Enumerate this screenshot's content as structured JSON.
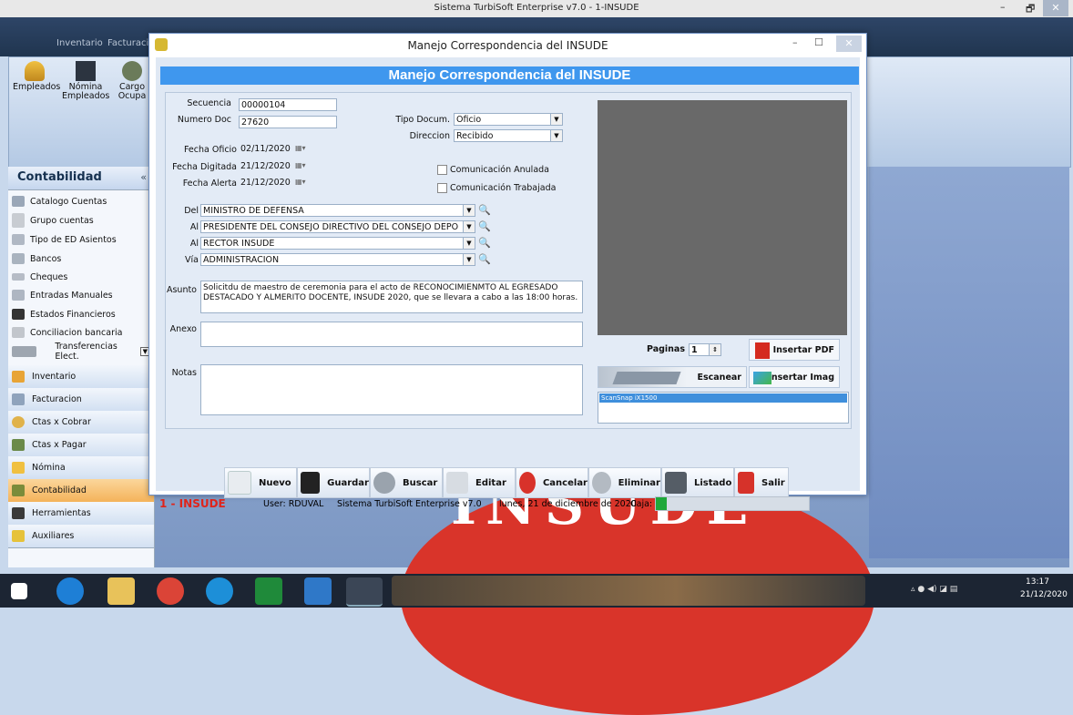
{
  "outer_window": {
    "title": "Sistema TurbiSoft Enterprise v7.0 - 1-INSUDE",
    "controls": [
      "–",
      "🗗",
      "✕"
    ],
    "menu": [
      "Inventario",
      "Facturacio"
    ]
  },
  "ribbon": {
    "buttons": [
      {
        "label": "Empleados",
        "icon": "employees-icon"
      },
      {
        "label": "Nómina Empleados",
        "icon": "payroll-icon"
      },
      {
        "label": "Cargo Ocupa",
        "icon": "position-icon"
      }
    ]
  },
  "left_panel": {
    "header": "Contabilidad",
    "collapse": "«",
    "items": [
      {
        "label": "Catalogo Cuentas",
        "icon": "catalog-icon"
      },
      {
        "label": "Grupo cuentas",
        "icon": "group-icon"
      },
      {
        "label": "Tipo de ED Asientos",
        "icon": "entries-type-icon"
      },
      {
        "label": "Bancos",
        "icon": "bank-icon"
      },
      {
        "label": "Cheques",
        "icon": "cheque-icon"
      },
      {
        "label": "Entradas Manuales",
        "icon": "manual-entries-icon"
      },
      {
        "label": "Estados Financieros",
        "icon": "financial-statements-icon"
      },
      {
        "label": "Conciliacion bancaria",
        "icon": "reconciliation-icon"
      },
      {
        "label": "Transferencias Elect.",
        "icon": "transfer-icon"
      }
    ],
    "nav": [
      {
        "label": "Inventario",
        "icon": "inventory-icon",
        "active": false
      },
      {
        "label": "Facturacion",
        "icon": "billing-icon",
        "active": false
      },
      {
        "label": "Ctas x Cobrar",
        "icon": "receivables-icon",
        "active": false
      },
      {
        "label": "Ctas x Pagar",
        "icon": "payables-icon",
        "active": false
      },
      {
        "label": "Nómina",
        "icon": "payroll-nav-icon",
        "active": false
      },
      {
        "label": "Contabilidad",
        "icon": "accounting-icon",
        "active": true
      },
      {
        "label": "Herramientas",
        "icon": "tools-icon",
        "active": false
      },
      {
        "label": "Auxiliares",
        "icon": "auxiliary-icon",
        "active": false
      }
    ]
  },
  "background_logo": {
    "text": "INSUDE"
  },
  "dialog": {
    "title": "Manejo Correspondencia del INSUDE",
    "banner": "Manejo Correspondencia del INSUDE",
    "controls": [
      "–",
      "☐",
      "✕"
    ],
    "fields": {
      "secuencia_label": "Secuencia",
      "secuencia_value": "00000104",
      "numero_doc_label": "Numero Doc",
      "numero_doc_value": "27620",
      "tipo_docum_label": "Tipo Docum.",
      "tipo_docum_value": "Oficio",
      "direccion_label": "Direccion",
      "direccion_value": "Recibido",
      "fecha_oficio_label": "Fecha Oficio",
      "fecha_oficio_value": "02/11/2020",
      "fecha_digitada_label": "Fecha Digitada",
      "fecha_digitada_value": "21/12/2020",
      "fecha_alerta_label": "Fecha Alerta",
      "fecha_alerta_value": "21/12/2020",
      "comunicacion_anulada": "Comunicación Anulada",
      "comunicacion_trabajada": "Comunicación Trabajada",
      "del_label": "Del",
      "del_value": "MINISTRO DE DEFENSA",
      "al1_label": "Al",
      "al1_value": "PRESIDENTE DEL CONSEJO DIRECTIVO DEL CONSEJO DEPO",
      "al2_label": "Al",
      "al2_value": "RECTOR INSUDE",
      "via_label": "Vía",
      "via_value": "ADMINISTRACION",
      "asunto_label": "Asunto",
      "asunto_value": "Solicitdu de maestro de ceremonia para el acto de RECONOCIMIENMTO AL EGRESADO DESTACADO Y ALMERITO DOCENTE, INSUDE 2020, que se llevara a cabo a las 18:00 horas.",
      "anexo_label": "Anexo",
      "anexo_value": "",
      "notas_label": "Notas",
      "notas_value": ""
    },
    "pages_label": "Paginas",
    "pages_value": "1",
    "insert_pdf": "Insertar PDF",
    "scan": "Escanear",
    "insert_image": "Insertar Imag",
    "scanner_selected": "ScanSnap iX1500",
    "toolbar": {
      "nuevo": "Nuevo",
      "guardar": "Guardar",
      "buscar": "Buscar",
      "editar": "Editar",
      "cancelar": "Cancelar",
      "eliminar": "Eliminar",
      "listado": "Listado",
      "salir": "Salir"
    },
    "status": {
      "company": "1 - INSUDE",
      "user": "User: RDUVAL",
      "system": "Sistema TurbiSoft Enterprise v7.0",
      "date": "lunes, 21 de diciembre de 2020",
      "caja": "Caja:"
    }
  },
  "taskbar": {
    "time": "13:17",
    "date": "21/12/2020"
  }
}
